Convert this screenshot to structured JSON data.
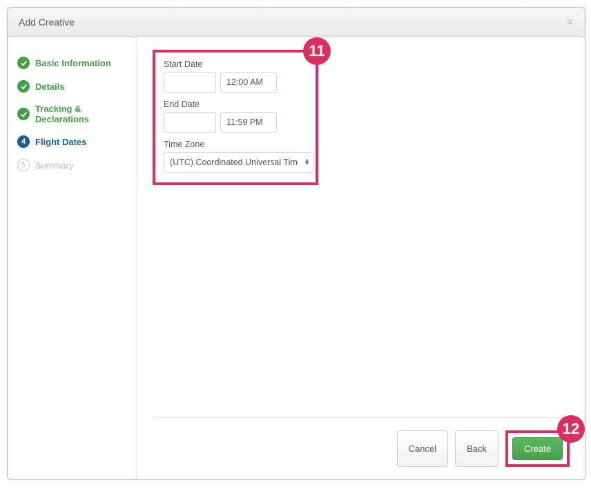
{
  "modal": {
    "title": "Add Creative"
  },
  "sidebar": {
    "steps": [
      {
        "label": "Basic Information",
        "status": "completed"
      },
      {
        "label": "Details",
        "status": "completed"
      },
      {
        "label": "Tracking & Declarations",
        "status": "completed"
      },
      {
        "label": "Flight Dates",
        "status": "active",
        "number": "4"
      },
      {
        "label": "Summary",
        "status": "pending",
        "number": "5"
      }
    ]
  },
  "form": {
    "start_date_label": "Start Date",
    "start_date_value": "",
    "start_time_value": "12:00 AM",
    "end_date_label": "End Date",
    "end_date_value": "",
    "end_time_value": "11:59 PM",
    "timezone_label": "Time Zone",
    "timezone_value": "(UTC) Coordinated Universal Time"
  },
  "footer": {
    "cancel_label": "Cancel",
    "back_label": "Back",
    "create_label": "Create"
  },
  "annotations": {
    "callout_11": "11",
    "callout_12": "12"
  }
}
